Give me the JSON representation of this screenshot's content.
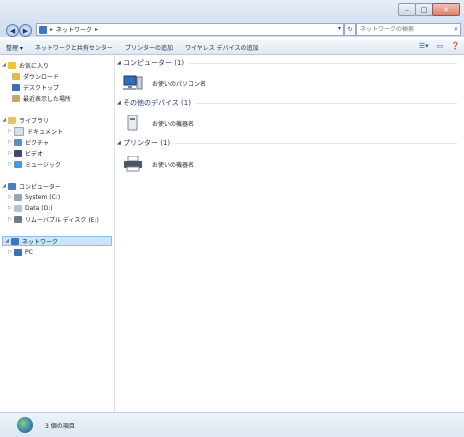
{
  "window": {
    "caption_buttons": {
      "minimize": "–",
      "maximize": "□",
      "close": "✕"
    }
  },
  "address_bar": {
    "segments": [
      "ネットワーク"
    ],
    "separator": "▸"
  },
  "search": {
    "placeholder": "ネットワークの検索"
  },
  "toolbar": {
    "items": [
      "整理 ▾",
      "ネットワークと共有センター",
      "プリンターの追加",
      "ワイヤレス デバイスの追加"
    ]
  },
  "nav": {
    "favorites": {
      "label": "お気に入り",
      "items": [
        "ダウンロード",
        "デスクトップ",
        "最近表示した場所"
      ]
    },
    "libraries": {
      "label": "ライブラリ",
      "items": [
        "ドキュメント",
        "ピクチャ",
        "ビデオ",
        "ミュージック"
      ]
    },
    "computer": {
      "label": "コンピューター",
      "items": [
        "System (C:)",
        "Data (D:)",
        "リムーバブル ディスク (E:)"
      ]
    },
    "network": {
      "label": "ネットワーク",
      "items": [
        "PC"
      ]
    }
  },
  "content": {
    "groups": [
      {
        "title": "コンピューター (1)",
        "item": "お使いのパソコン名"
      },
      {
        "title": "その他のデバイス (1)",
        "item": "お使いの機器名"
      },
      {
        "title": "プリンター (1)",
        "item": "お使いの機器名"
      }
    ]
  },
  "status": {
    "text": "3 個の項目"
  },
  "colors": {
    "accent": "#1e3287",
    "selection": "#cce4fb",
    "chrome": "#d6e3f2"
  }
}
